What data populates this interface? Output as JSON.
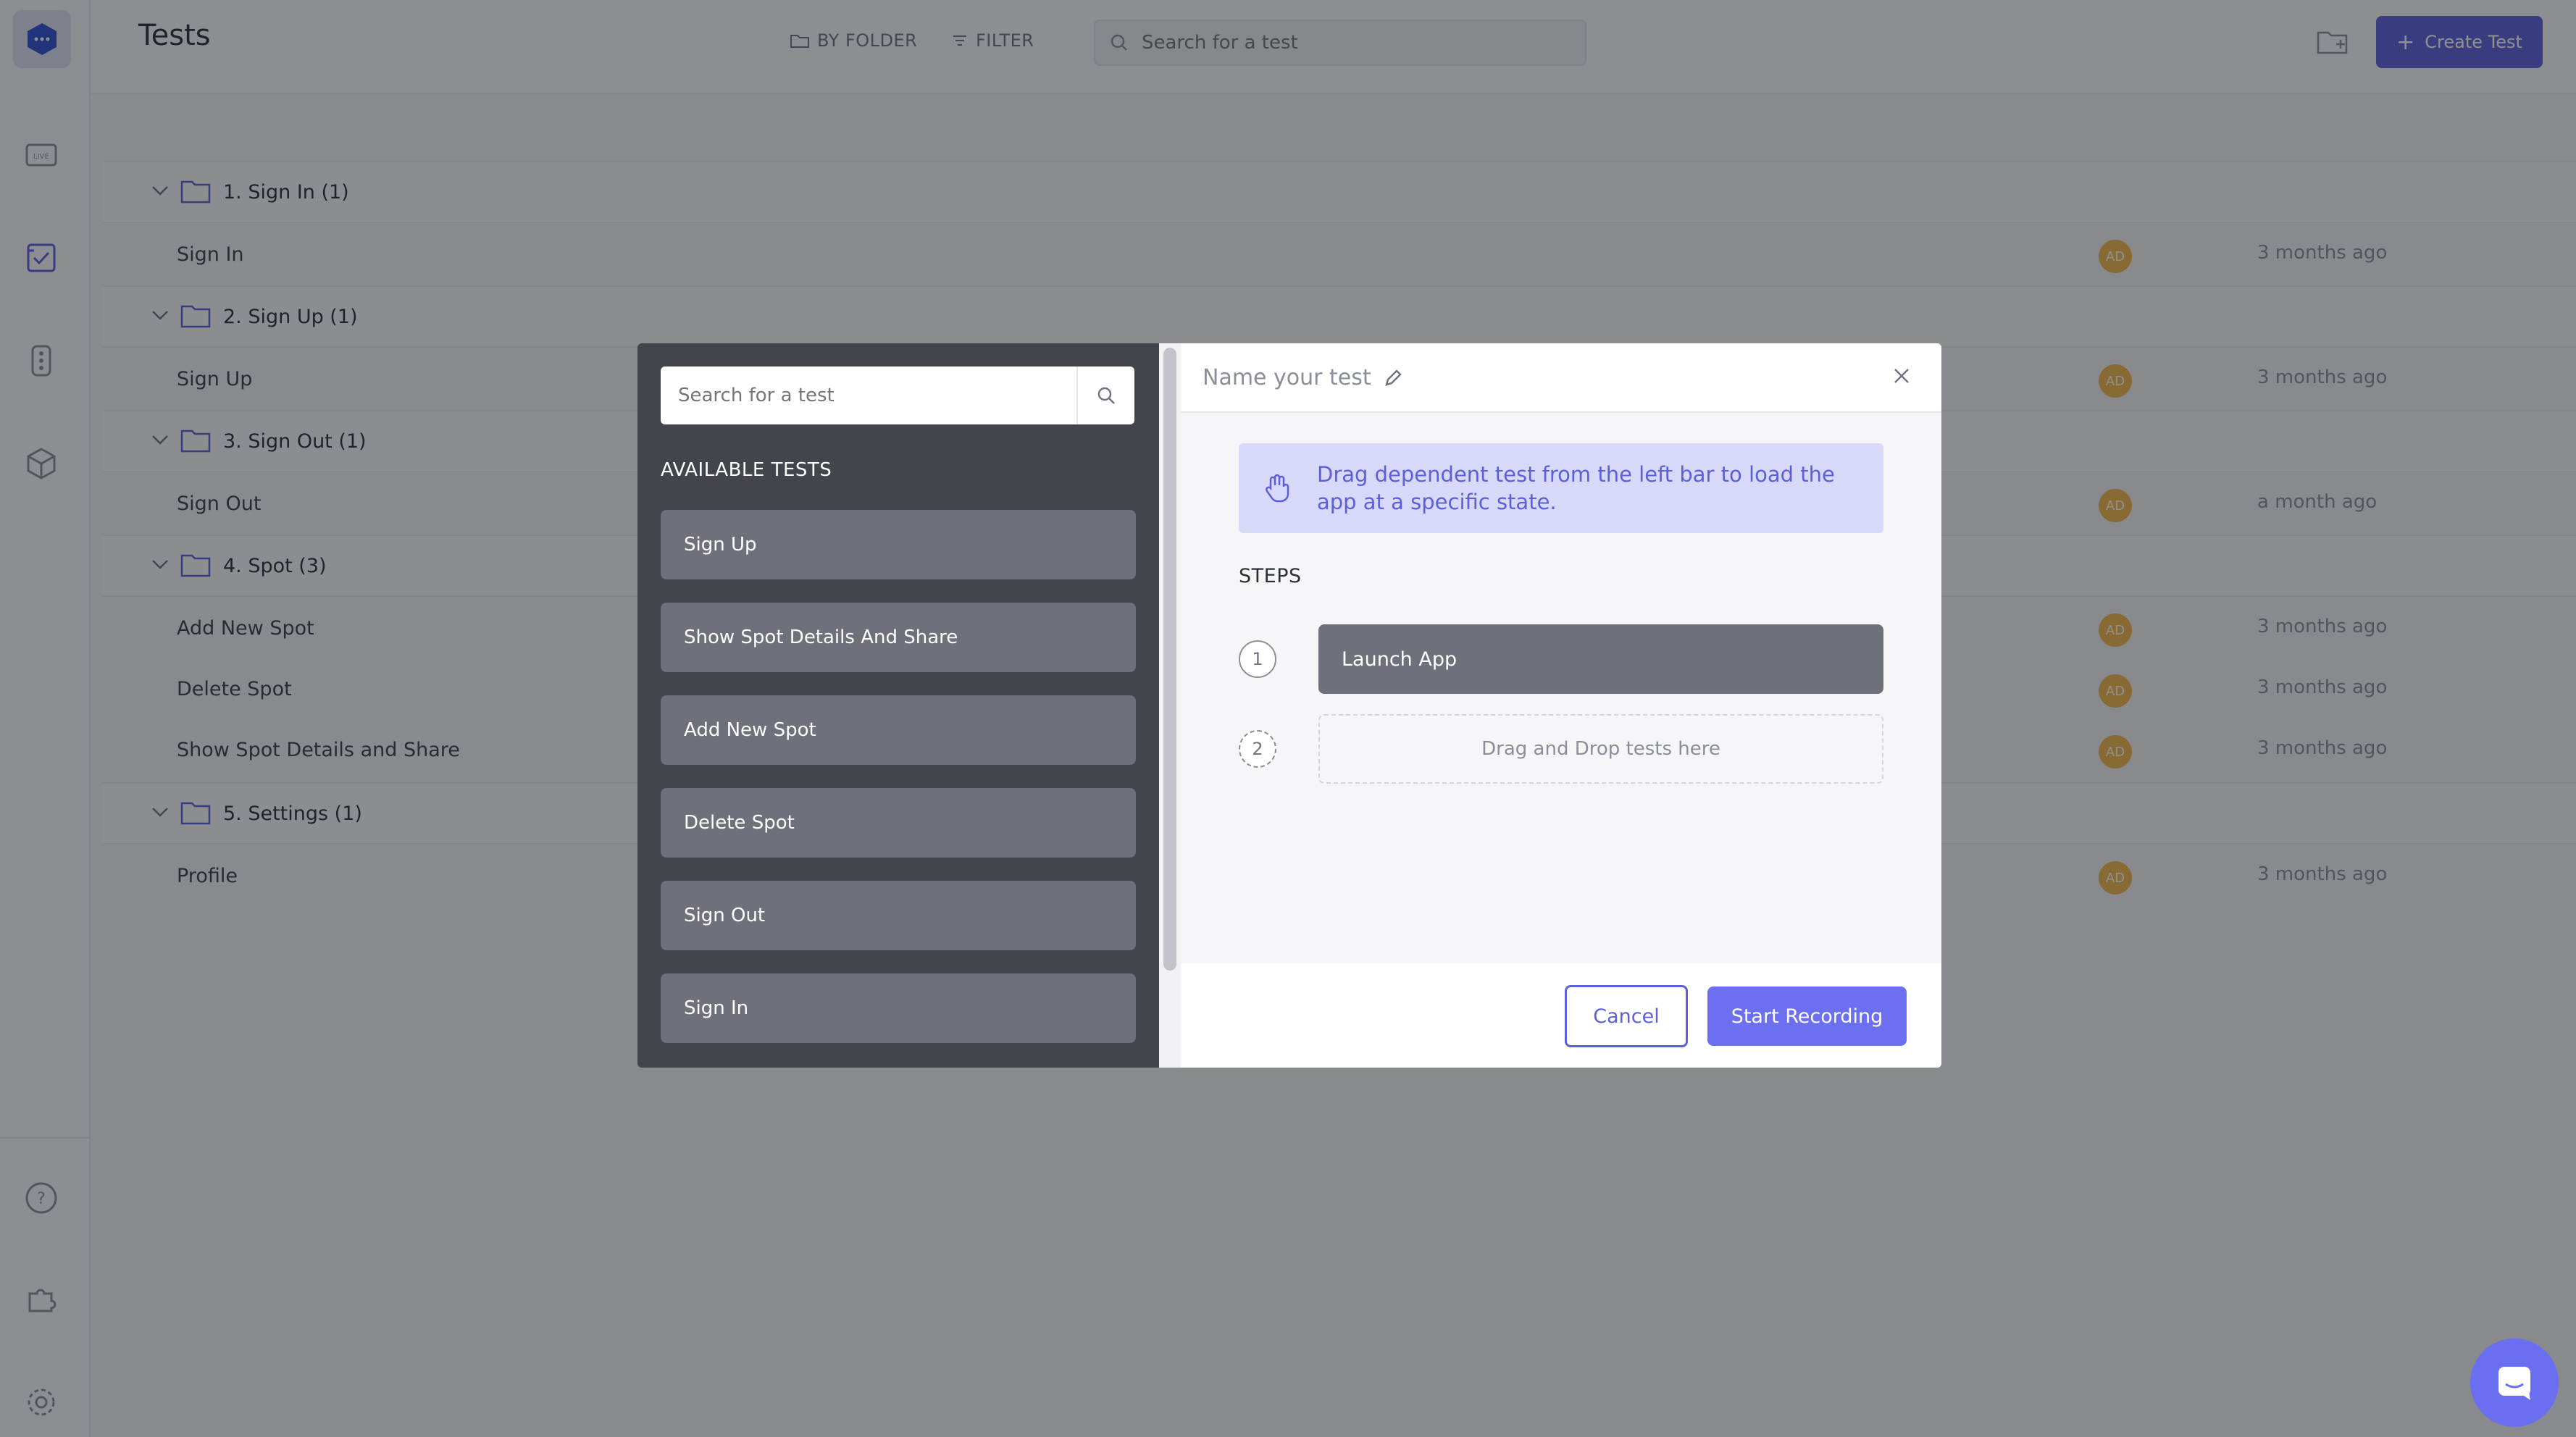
{
  "page": {
    "title": "Tests"
  },
  "toolbar": {
    "by_folder_label": "BY FOLDER",
    "filter_label": "FILTER",
    "search_placeholder": "Search for a test",
    "create_label": "Create Test"
  },
  "sidebar": {
    "icons": [
      "logo-icon",
      "live-icon",
      "tests-icon",
      "traffic-light-icon",
      "box-icon",
      "help-icon",
      "puzzle-icon",
      "settings-icon"
    ]
  },
  "folders": [
    {
      "label": "1. Sign In (1)",
      "tests": [
        {
          "name": "Sign In",
          "avatar": "AD",
          "time": "3 months ago"
        }
      ]
    },
    {
      "label": "2. Sign Up (1)",
      "tests": [
        {
          "name": "Sign Up",
          "avatar": "AD",
          "time": "3 months ago"
        }
      ]
    },
    {
      "label": "3. Sign Out (1)",
      "tests": [
        {
          "name": "Sign Out",
          "avatar": "AD",
          "time": "a month ago"
        }
      ]
    },
    {
      "label": "4. Spot (3)",
      "tests": [
        {
          "name": "Add New Spot",
          "avatar": "AD",
          "time": "3 months ago"
        },
        {
          "name": "Delete Spot",
          "avatar": "AD",
          "time": "3 months ago"
        },
        {
          "name": "Show Spot Details and Share",
          "avatar": "AD",
          "time": "3 months ago"
        }
      ]
    },
    {
      "label": "5. Settings (1)",
      "tests": [
        {
          "name": "Profile",
          "avatar": "AD",
          "time": "3 months ago"
        }
      ]
    }
  ],
  "modal": {
    "search_placeholder": "Search for a test",
    "available_title": "AVAILABLE TESTS",
    "available_tests": [
      "Sign Up",
      "Show Spot Details And Share",
      "Add New Spot",
      "Delete Spot",
      "Sign Out",
      "Sign In"
    ],
    "name_placeholder": "Name your test",
    "hint": "Drag dependent test from the left bar to load the app at a specific state.",
    "steps_title": "STEPS",
    "steps": [
      {
        "num": "1",
        "label": "Launch App"
      }
    ],
    "drop_step_num": "2",
    "drop_label": "Drag and Drop tests here",
    "cancel_label": "Cancel",
    "record_label": "Start Recording"
  },
  "colors": {
    "accent": "#5b5fd9",
    "avatar": "#f0b64b",
    "modal_dark": "#42454c",
    "item_bg": "#6e717a",
    "hint_bg": "#d8d9f8"
  }
}
